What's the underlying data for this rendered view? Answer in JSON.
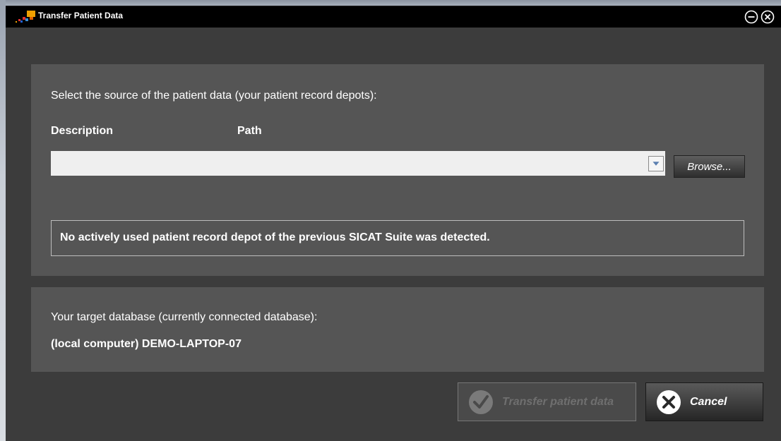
{
  "window": {
    "title": "Transfer Patient Data",
    "minimize_icon": "minimize-circle-icon",
    "close_icon": "close-circle-icon"
  },
  "source_panel": {
    "instruction": "Select the source of the patient data (your patient record depots):",
    "col_description": "Description",
    "col_path": "Path",
    "depot_select_value": "",
    "browse_label": "Browse...",
    "notice": "No actively used patient record depot of the previous SICAT Suite was detected."
  },
  "target_panel": {
    "label": "Your target database (currently connected database):",
    "value": "(local computer) DEMO-LAPTOP-07"
  },
  "actions": {
    "transfer_label": "Transfer patient data",
    "transfer_enabled": false,
    "cancel_label": "Cancel"
  },
  "colors": {
    "dialog_bg": "#3c3c3c",
    "panel_bg": "#555555",
    "titlebar_bg": "#000000"
  }
}
